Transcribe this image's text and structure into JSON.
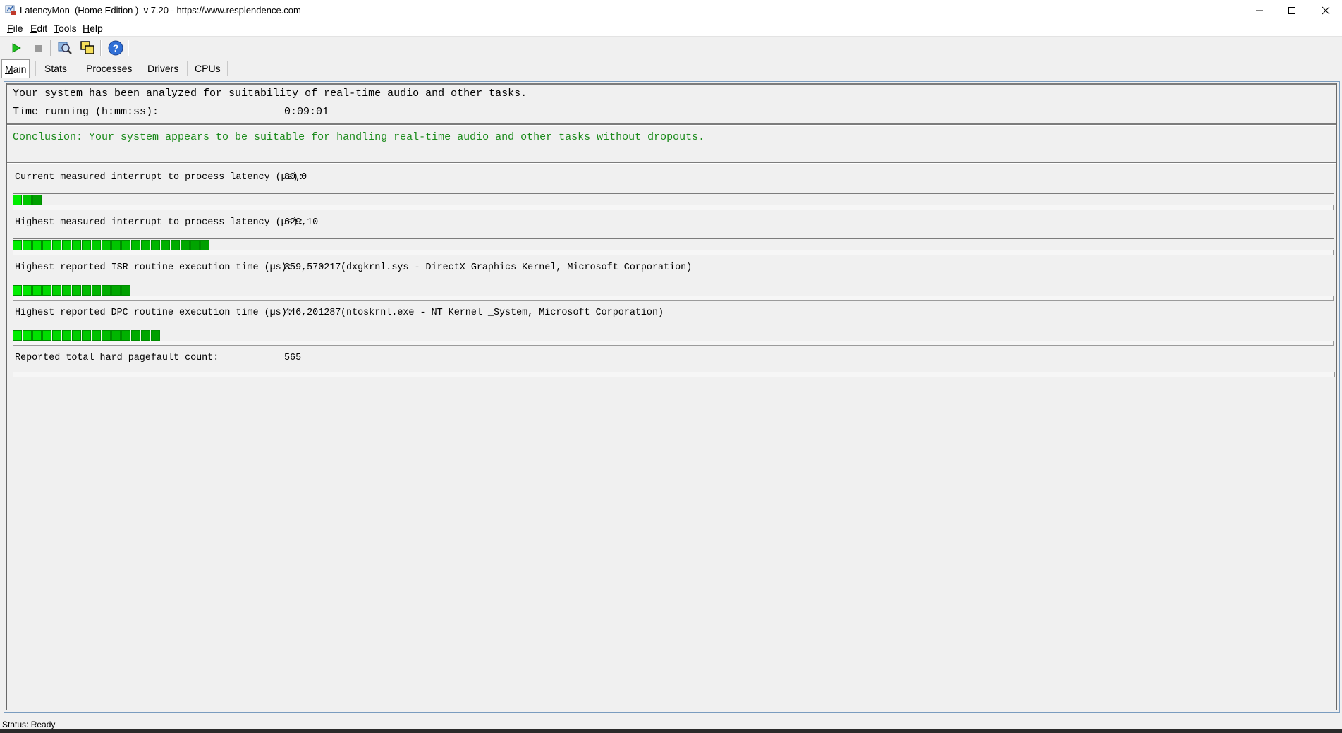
{
  "window": {
    "title": "LatencyMon  (Home Edition )  v 7.20 - https://www.resplendence.com",
    "app_icon": "latencymon-icon"
  },
  "menu": [
    {
      "label": "File",
      "accel": "F",
      "rest": "ile"
    },
    {
      "label": "Edit",
      "accel": "E",
      "rest": "dit"
    },
    {
      "label": "Tools",
      "accel": "T",
      "rest": "ools"
    },
    {
      "label": "Help",
      "accel": "H",
      "rest": "elp"
    }
  ],
  "toolbar": {
    "start": "play-icon",
    "stop": "stop-icon",
    "search": "analyze-icon",
    "windows": "windows-icon",
    "help": "help-icon"
  },
  "tabs": [
    {
      "label": "Main",
      "accel": "M",
      "rest": "ain",
      "active": true
    },
    {
      "label": "Stats",
      "accel": "S",
      "rest": "tats",
      "active": false
    },
    {
      "label": "Processes",
      "accel": "P",
      "rest": "rocesses",
      "active": false
    },
    {
      "label": "Drivers",
      "accel": "D",
      "rest": "rivers",
      "active": false
    },
    {
      "label": "CPUs",
      "accel": "C",
      "rest": "PUs",
      "active": false
    }
  ],
  "main": {
    "analyzed_line": "Your system has been analyzed for suitability of real-time audio and other tasks.",
    "time_running_label": "Time running (h:mm:ss):",
    "time_running_value": "0:09:01",
    "conclusion": "Conclusion: Your system appears to be suitable for handling real-time audio and other tasks without dropouts.",
    "metrics": [
      {
        "label": "Current measured interrupt to process latency (µs):",
        "value": "80,0",
        "detail": "",
        "bar_cells": 3
      },
      {
        "label": "Highest measured interrupt to process latency (µs):",
        "value": "629,10",
        "detail": "",
        "bar_cells": 20
      },
      {
        "label": "Highest reported ISR routine execution time (µs):",
        "value": "359,570217",
        "detail": "(dxgkrnl.sys - DirectX Graphics Kernel, Microsoft Corporation)",
        "bar_cells": 12
      },
      {
        "label": "Highest reported DPC routine execution time (µs):",
        "value": "446,201287",
        "detail": "(ntoskrnl.exe - NT Kernel _System, Microsoft Corporation)",
        "bar_cells": 15
      },
      {
        "label": "Reported total hard pagefault count:",
        "value": "565",
        "detail": "",
        "bar_cells": 0
      }
    ],
    "bar_colors": {
      "bright": "#00ee00",
      "dark": "#00a000"
    }
  },
  "status": {
    "text": "Status: Ready"
  }
}
